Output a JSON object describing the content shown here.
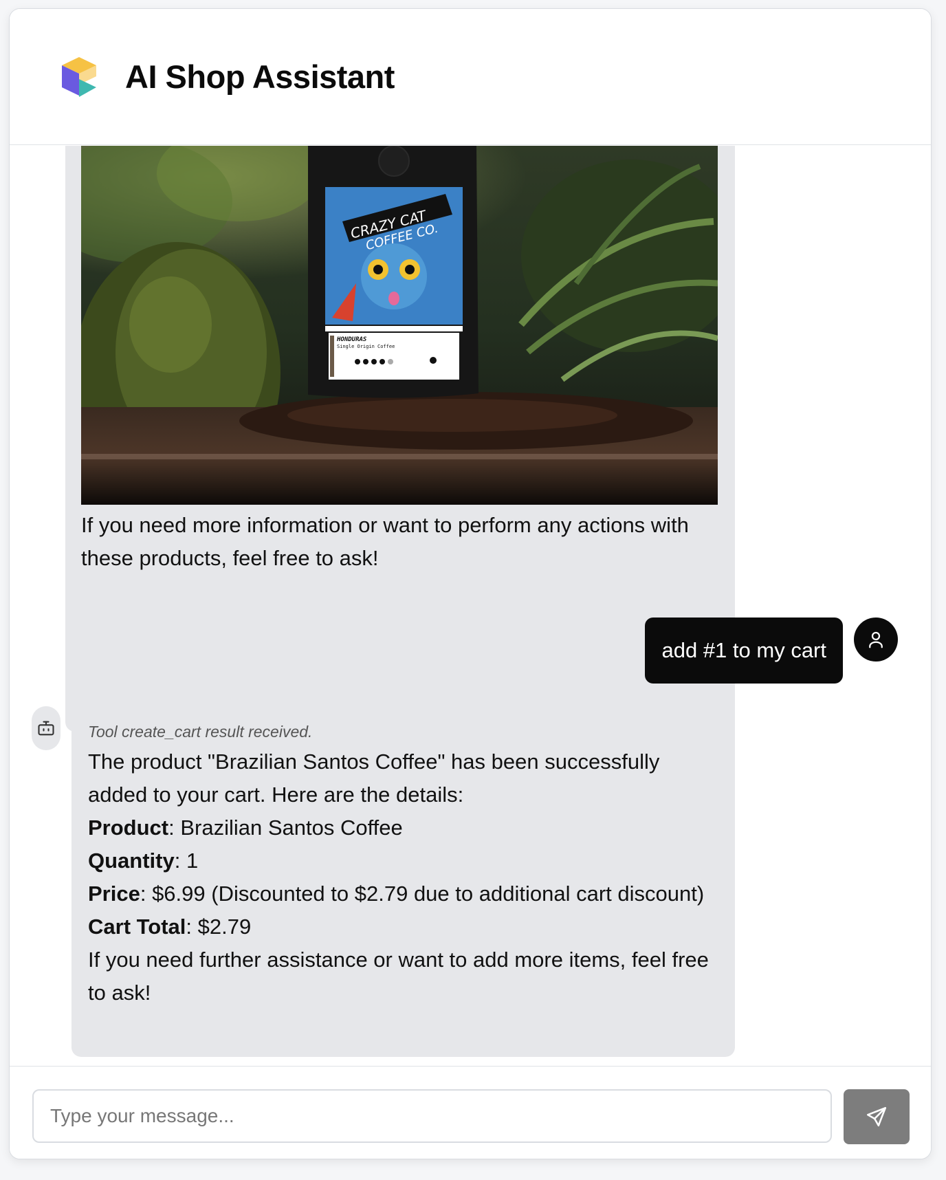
{
  "header": {
    "title": "AI Shop Assistant"
  },
  "messages": {
    "top_bot": {
      "image_label_brand": "CRAZY CAT COFFEE CO.",
      "image_label_origin": "HONDURAS",
      "image_label_sub": "Single Origin Coffee",
      "closing_text": "If you need more information or want to perform any actions with these products, feel free to ask!"
    },
    "user": {
      "text": "add #1 to my cart"
    },
    "bot": {
      "tool_note": "Tool create_cart result received.",
      "intro": "The product \"Brazilian Santos Coffee\" has been successfully added to your cart. Here are the details:",
      "product_label": "Product",
      "product_value": ": Brazilian Santos Coffee",
      "quantity_label": "Quantity",
      "quantity_value": ": 1",
      "price_label": "Price",
      "price_value": ": $6.99 (Discounted to $2.79 due to additional cart discount)",
      "total_label": "Cart Total",
      "total_value": ": $2.79",
      "outro": "If you need further assistance or want to add more items, feel free to ask!"
    }
  },
  "composer": {
    "placeholder": "Type your message..."
  },
  "colors": {
    "user_bubble": "#0b0b0b",
    "bot_bubble": "#e6e7ea",
    "send_button": "#7d7d7d"
  },
  "icons": {
    "logo": "cube-logo-icon",
    "user": "user-icon",
    "bot": "robot-icon",
    "send": "send-icon"
  }
}
